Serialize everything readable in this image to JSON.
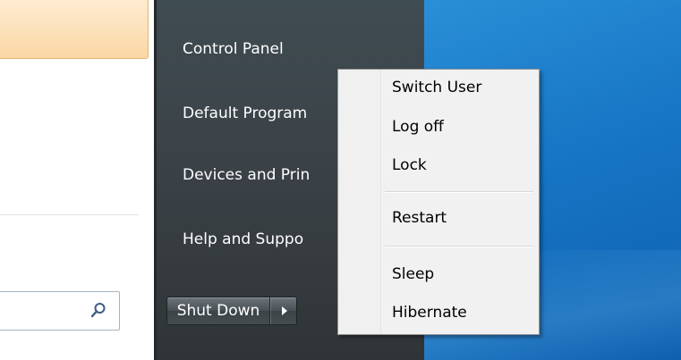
{
  "right_pane": {
    "items": [
      {
        "label": "Control Panel"
      },
      {
        "label": "Default Program"
      },
      {
        "label": "Devices and Prin"
      },
      {
        "label": "Help and Suppo"
      }
    ],
    "shutdown": {
      "label": "Shut Down",
      "arrow_icon": "right-triangle-icon"
    }
  },
  "search": {
    "value": "",
    "icon": "search-icon"
  },
  "submenu": {
    "items": [
      {
        "label": "Switch User"
      },
      {
        "label": "Log off"
      },
      {
        "label": "Lock"
      },
      {
        "label": "Restart"
      },
      {
        "label": "Sleep"
      },
      {
        "label": "Hibernate"
      }
    ]
  },
  "colors": {
    "dark_pane": "#3b4247",
    "desktop": "#1776c6",
    "highlight": "#fcd7a5",
    "submenu_bg": "#f1f1f1"
  }
}
